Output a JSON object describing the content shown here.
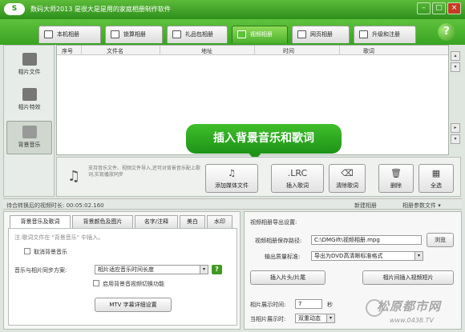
{
  "titlebar": {
    "logo": "S",
    "title": "数码大师2013  是很大是是用的家庭相册制作软件",
    "btn_min": "–",
    "btn_max": "□",
    "btn_close": "×"
  },
  "tabs": [
    {
      "label": "本机相册"
    },
    {
      "label": "锁算相册"
    },
    {
      "label": "礼品包相册"
    },
    {
      "label": "视频相册"
    },
    {
      "label": "网页相册"
    },
    {
      "label": "升级和注册"
    }
  ],
  "help_label": "?",
  "leftnav": {
    "items": [
      {
        "label": "相片文件"
      },
      {
        "label": "相片特效"
      },
      {
        "label": "背景音乐"
      }
    ]
  },
  "list": {
    "columns": [
      "序号",
      "文件名",
      "地址",
      "时间",
      "歌词"
    ]
  },
  "scroll_buttons": [
    "▴",
    "▾",
    "▸",
    "▾"
  ],
  "callout": "插入背景音乐和歌词",
  "toolbar": {
    "note": "支持音乐文件、视频文件导入,还可对背景音乐配上歌词,实现播放同步",
    "buttons": [
      {
        "label": "添加媒体文件",
        "icon": "♫"
      },
      {
        "label": "插入歌词",
        "icon": ".LRC"
      },
      {
        "label": "清除歌词",
        "icon": "⌫"
      },
      {
        "label": "删除",
        "icon": "🗑"
      },
      {
        "label": "全选",
        "icon": "▦"
      }
    ]
  },
  "bottombar": {
    "status": "待合转换后的视频时长:  00:05:02.160",
    "new_album": "新建相册",
    "album_params": "相册参数文件 ▾"
  },
  "subtabs": [
    "背景音乐及歌词",
    "背景颜色及图片",
    "名字/注释",
    "美白",
    "水印"
  ],
  "music_panel": {
    "hint": "注:歌词文件在 \"背景音乐\" 中插入。",
    "cancel_music": "取消背景音乐",
    "sync_label": "音乐与相片同步方案:",
    "sync_value": "相片适应音乐时间长度",
    "switch_bg": "启用背景音视频切换功能",
    "mtv_btn": "MTV 字幕详细设置"
  },
  "output_panel": {
    "title": "视频相册导出设置:",
    "save_path_label": "视频相册保存路径:",
    "save_path_value": "C:\\DMGift\\视频相册.mpg",
    "browse": "浏览",
    "quality_label": "输出质量标准:",
    "quality_value": "导出为DVD高清晰标准格式",
    "insert_head_tail": "插入片头/片尾",
    "insert_between": "相片间插入视频短片",
    "display_time_label": "相片展示时间:",
    "display_time_value": "7",
    "display_time_unit": "秒",
    "animation_label": "当相片展示时:",
    "animation_value": "双重动态"
  },
  "watermark": {
    "name": "松原都市网",
    "url": "www.0438.TV"
  }
}
